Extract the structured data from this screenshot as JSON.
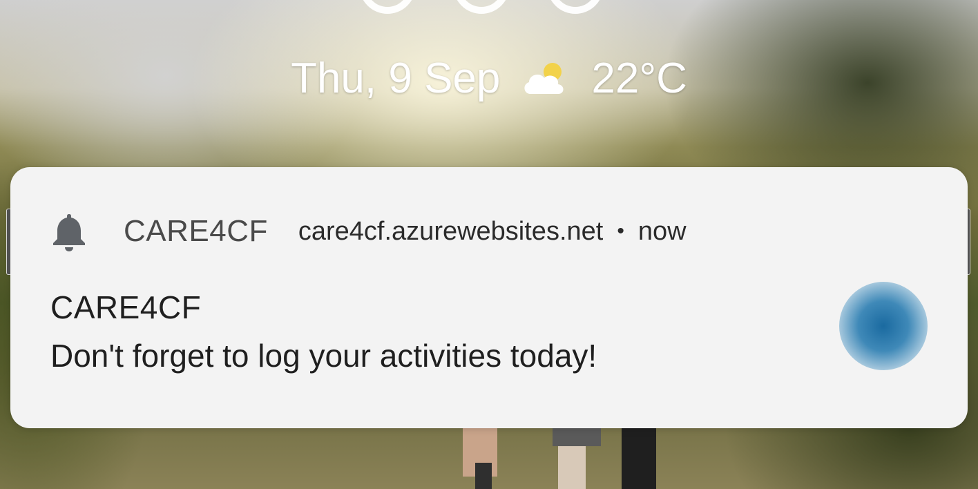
{
  "lockscreen": {
    "date": "Thu, 9 Sep",
    "weather_icon": "partly-cloudy-icon",
    "temperature": "22°C"
  },
  "notification": {
    "icon": "bell-icon",
    "app_name": "CARE4CF",
    "source": "care4cf.azurewebsites.net",
    "separator": "•",
    "time": "now",
    "title": "CARE4CF",
    "text": "Don't forget to log your activities today!",
    "large_icon": "blue-circle-app-icon"
  },
  "colors": {
    "card_background": "#f3f3f3",
    "large_icon_blue": "#1a6aa0",
    "text_primary": "#1f1f1f",
    "text_secondary": "#4a4a4a"
  }
}
